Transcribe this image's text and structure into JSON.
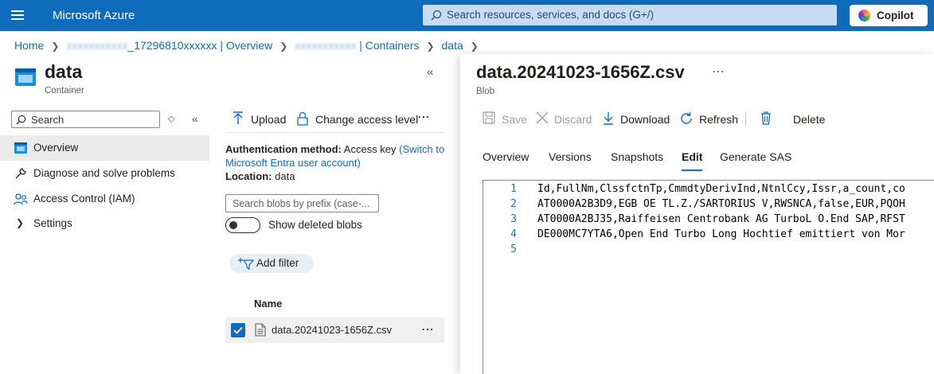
{
  "topbar": {
    "brand": "Microsoft Azure",
    "search_placeholder": "Search resources, services, and docs (G+/)",
    "copilot_label": "Copilot"
  },
  "breadcrumb": {
    "home": "Home",
    "account_prefix": "xxxxxxxxxxx",
    "account_rest": "_17296810xxxxxx | Overview",
    "storage_prefix": "xxxxxxxxxxx",
    "storage_rest": " | Containers",
    "container": "data"
  },
  "container": {
    "title": "data",
    "subtitle": "Container"
  },
  "nav": {
    "search_placeholder": "Search",
    "items": [
      {
        "label": "Overview",
        "icon": "container-icon",
        "active": true
      },
      {
        "label": "Diagnose and solve problems",
        "icon": "wrench-icon",
        "active": false
      },
      {
        "label": "Access Control (IAM)",
        "icon": "people-icon",
        "active": false
      },
      {
        "label": "Settings",
        "icon": "chevron-right-icon",
        "active": false
      }
    ]
  },
  "list_pane": {
    "toolbar": {
      "upload": "Upload",
      "change_access": "Change access level"
    },
    "auth_label": "Authentication method:",
    "auth_value": "Access key",
    "auth_link": "(Switch to Microsoft Entra user account)",
    "location_label": "Location:",
    "location_value": "data",
    "blob_search_placeholder": "Search blobs by prefix (case-...",
    "show_deleted_label": "Show deleted blobs",
    "show_deleted_on": false,
    "add_filter": "Add filter",
    "column_name": "Name",
    "files": [
      {
        "name": "data.20241023-1656Z.csv",
        "selected": true
      }
    ]
  },
  "blob_panel": {
    "title": "data.20241023-1656Z.csv",
    "subtitle": "Blob",
    "toolbar": {
      "save": "Save",
      "discard": "Discard",
      "download": "Download",
      "refresh": "Refresh",
      "delete": "Delete"
    },
    "tabs": [
      "Overview",
      "Versions",
      "Snapshots",
      "Edit",
      "Generate SAS"
    ],
    "active_tab": "Edit",
    "editor_lines": [
      {
        "n": "1",
        "text": "Id,FullNm,ClssfctnTp,CmmdtyDerivInd,NtnlCcy,Issr,a_count,co"
      },
      {
        "n": "2",
        "text": "AT0000A2B3D9,EGB OE TL.Z./SARTORIUS V,RWSNCA,false,EUR,PQOH"
      },
      {
        "n": "3",
        "text": "AT0000A2BJ35,Raiffeisen Centrobank AG TurboL O.End SAP,RFST"
      },
      {
        "n": "4",
        "text": "DE000MC7YTA6,Open End Turbo Long Hochtief emittiert von Mor"
      },
      {
        "n": "5",
        "text": ""
      }
    ]
  },
  "colors": {
    "topbar": "#0f6cbd",
    "accent": "#0f6cbd",
    "line_number": "#237893"
  }
}
